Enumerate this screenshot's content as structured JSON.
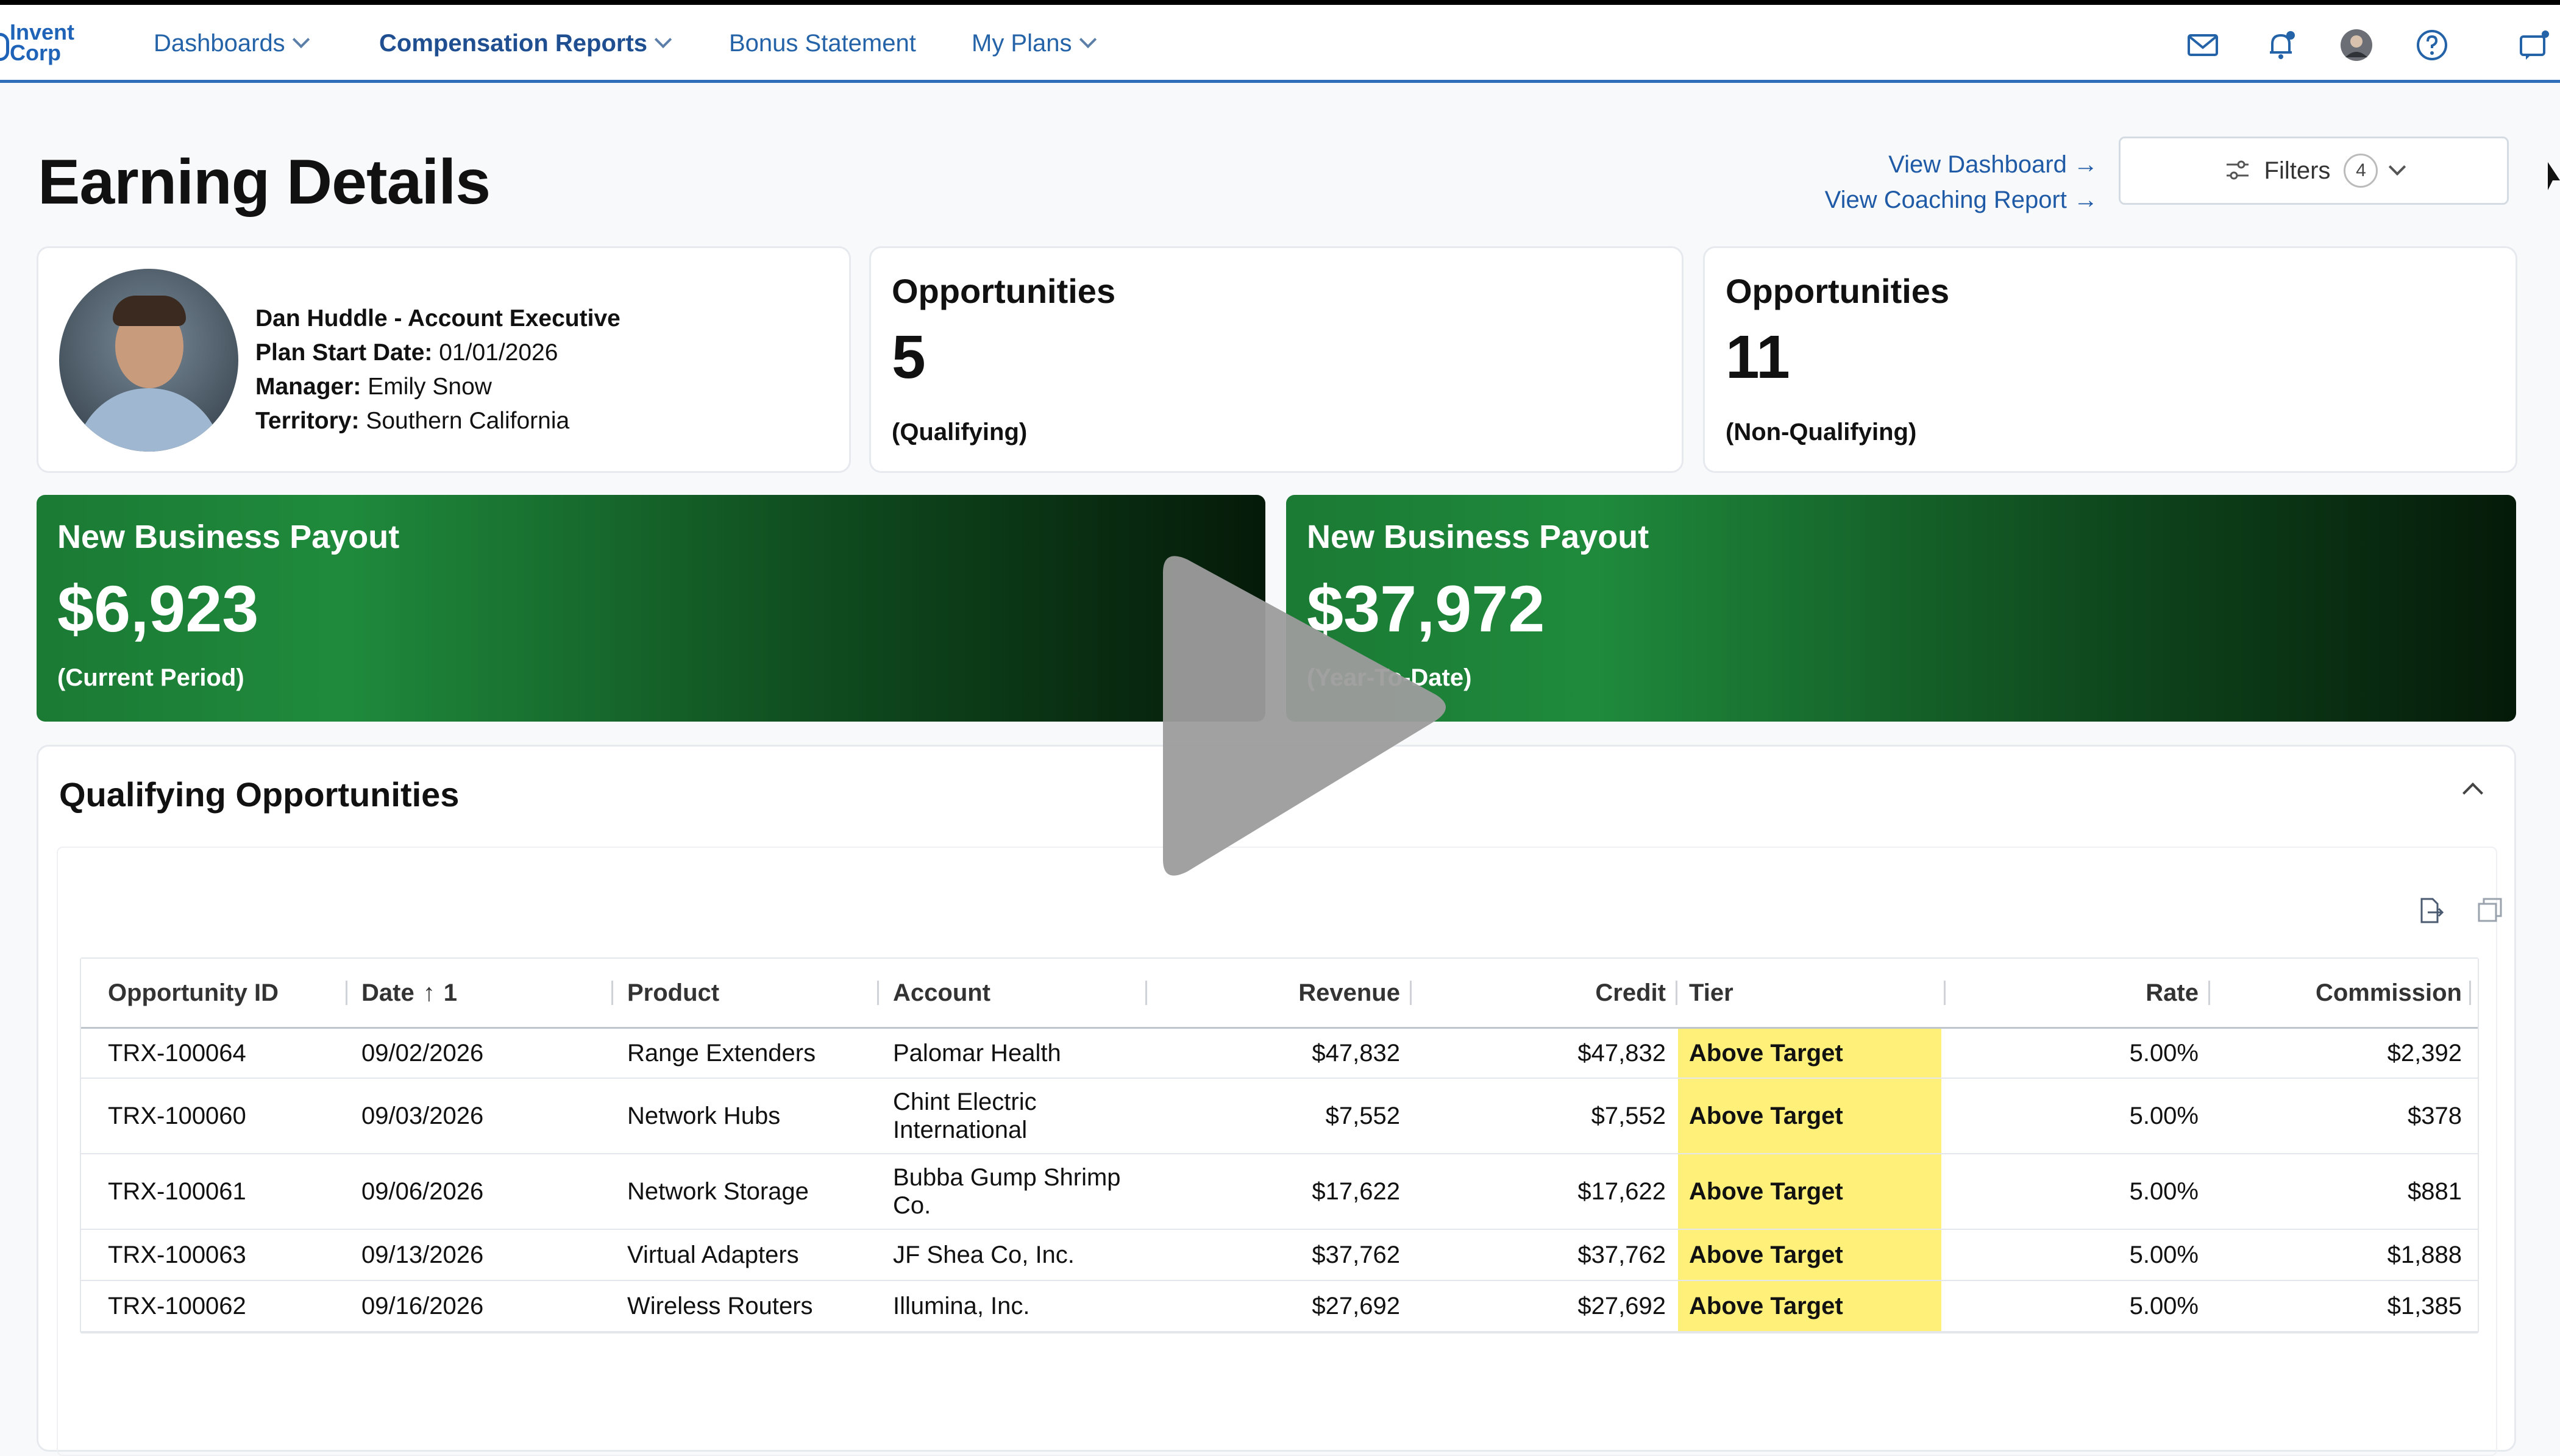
{
  "brand": {
    "name_line1": "Invent",
    "name_line2": "Corp"
  },
  "nav": {
    "items": [
      {
        "label": "Dashboards",
        "has_menu": true
      },
      {
        "label": "Compensation Reports",
        "has_menu": true,
        "active": true
      },
      {
        "label": "Bonus Statement",
        "has_menu": false
      },
      {
        "label": "My Plans",
        "has_menu": true
      }
    ],
    "icons": [
      "mail-icon",
      "bell-icon",
      "user-avatar-icon",
      "help-icon",
      "chat-icon"
    ]
  },
  "page": {
    "title": "Earning Details",
    "links": {
      "dashboard": "View Dashboard →",
      "coaching": "View Coaching Report →"
    },
    "filters": {
      "label": "Filters",
      "count": "4"
    }
  },
  "profile": {
    "name_role": "Dan Huddle - Account Executive",
    "plan_start_label": "Plan Start Date:",
    "plan_start_value": " 01/01/2026",
    "manager_label": "Manager:",
    "manager_value": " Emily Snow",
    "territory_label": "Territory:",
    "territory_value": " Southern California"
  },
  "stats": [
    {
      "title": "Opportunities",
      "value": "5",
      "subtitle": "(Qualifying)"
    },
    {
      "title": "Opportunities",
      "value": "11",
      "subtitle": "(Non-Qualifying)"
    }
  ],
  "payouts": [
    {
      "title": "New Business Payout",
      "value": "$6,923",
      "subtitle": "(Current Period)"
    },
    {
      "title": "New Business Payout",
      "value": "$37,972",
      "subtitle": "(Year-To-Date)"
    }
  ],
  "qualifying": {
    "title": "Qualifying Opportunities",
    "columns": {
      "id": "Opportunity ID",
      "date": "Date",
      "sort_index": "1",
      "product": "Product",
      "account": "Account",
      "revenue": "Revenue",
      "credit": "Credit",
      "tier": "Tier",
      "rate": "Rate",
      "commission": "Commission"
    },
    "rows": [
      {
        "id": "TRX-100064",
        "date": "09/02/2026",
        "product": "Range Extenders",
        "account": "Palomar Health",
        "revenue": "$47,832",
        "credit": "$47,832",
        "tier": "Above Target",
        "rate": "5.00%",
        "commission": "$2,392"
      },
      {
        "id": "TRX-100060",
        "date": "09/03/2026",
        "product": "Network Hubs",
        "account": "Chint Electric International",
        "revenue": "$7,552",
        "credit": "$7,552",
        "tier": "Above Target",
        "rate": "5.00%",
        "commission": "$378"
      },
      {
        "id": "TRX-100061",
        "date": "09/06/2026",
        "product": "Network Storage",
        "account": "Bubba Gump Shrimp Co.",
        "revenue": "$17,622",
        "credit": "$17,622",
        "tier": "Above Target",
        "rate": "5.00%",
        "commission": "$881"
      },
      {
        "id": "TRX-100063",
        "date": "09/13/2026",
        "product": "Virtual Adapters",
        "account": "JF Shea Co, Inc.",
        "revenue": "$37,762",
        "credit": "$37,762",
        "tier": "Above Target",
        "rate": "5.00%",
        "commission": "$1,888"
      },
      {
        "id": "TRX-100062",
        "date": "09/16/2026",
        "product": "Wireless Routers",
        "account": "Illumina, Inc.",
        "revenue": "$27,692",
        "credit": "$27,692",
        "tier": "Above Target",
        "rate": "5.00%",
        "commission": "$1,385"
      }
    ]
  },
  "colors": {
    "accent": "#2f6fba",
    "tier_highlight": "#fff07a",
    "payout_green": "#1f8a3c"
  }
}
